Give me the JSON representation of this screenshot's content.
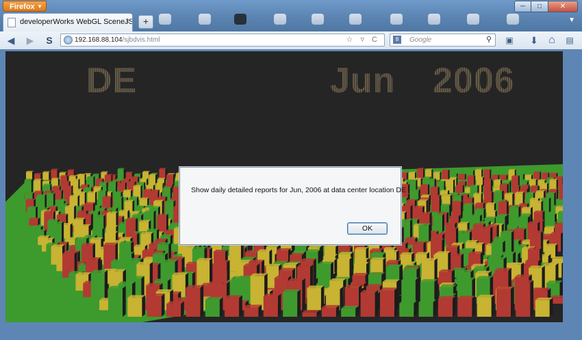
{
  "browser": {
    "menu_label": "Firefox",
    "window_controls": [
      "─",
      "□",
      "✕"
    ],
    "tab_title": "developerWorks WebGL SceneJS Big Dat...",
    "tab_close": "×",
    "new_tab": "+",
    "nav": {
      "back_icon": "◀",
      "forward_icon": "▶",
      "stumble_icon": "S",
      "url_host": "192.168.88.104",
      "url_path": "/sjbdvis.html",
      "url_tools": "☆ ▿ C",
      "search_engine_icon": "8",
      "search_placeholder": "Google",
      "search_icon": "⚲",
      "bookmarks_icon": "▣",
      "download_icon": "⬇",
      "home_icon": "⌂",
      "addon_icon": "▤"
    }
  },
  "visualization": {
    "location_label": "DE",
    "month_label": "Jun",
    "year_label": "2006",
    "bar_colors": [
      "#b23a32",
      "#c8b332",
      "#3f9a2e",
      "#1f1f1f"
    ]
  },
  "alert": {
    "message": "Show daily detailed reports for Jun, 2006 at data center location DE",
    "ok_label": "OK"
  }
}
